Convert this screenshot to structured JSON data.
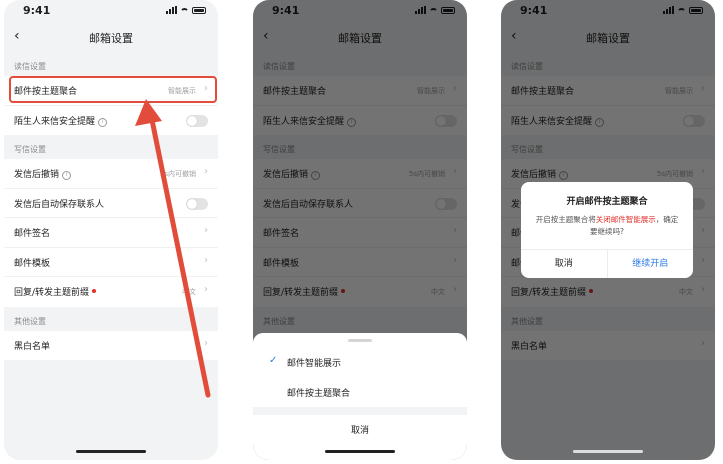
{
  "status_time": "9:41",
  "nav": {
    "title": "邮箱设置",
    "back": "‹"
  },
  "sections": {
    "read": "读信设置",
    "write": "写信设置",
    "other": "其他设置"
  },
  "rows": {
    "thread": {
      "label": "邮件按主题聚合",
      "value": "智能展示"
    },
    "stranger": {
      "label": "陌生人来信安全提醒"
    },
    "recall": {
      "label": "发信后撤销",
      "value": "5s内可撤销"
    },
    "autosave": {
      "label": "发信后自动保存联系人"
    },
    "signature": {
      "label": "邮件签名"
    },
    "template": {
      "label": "邮件模板"
    },
    "prefix": {
      "label": "回复/转发主题前缀",
      "value": "中文"
    },
    "blacklist": {
      "label": "黑白名单"
    }
  },
  "sheet": {
    "option1": "邮件智能展示",
    "option2": "邮件按主题聚合",
    "cancel": "取消"
  },
  "dialog": {
    "title": "开启邮件按主题聚合",
    "msg_pre": "开启按主题聚合将",
    "msg_red": "关闭邮件智能展示",
    "msg_post": "，确定要继续吗?",
    "cancel": "取消",
    "confirm": "继续开启"
  },
  "icons": {
    "info": "info-circle-icon",
    "chevron": "chevron-right-icon",
    "check": "check-icon"
  },
  "colors": {
    "accent": "#2c7be5",
    "highlight": "#e24c3b",
    "red_text": "#e0322b"
  }
}
